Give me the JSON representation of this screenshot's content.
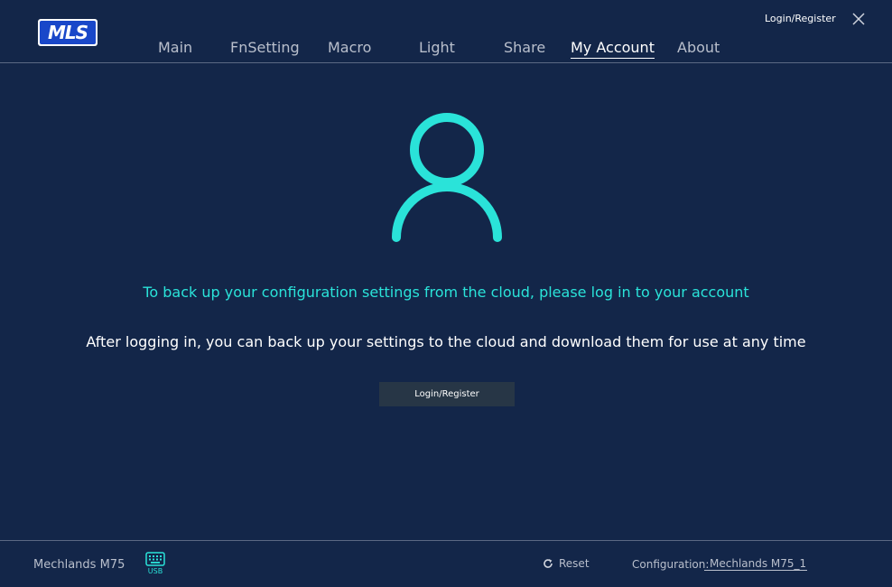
{
  "brand": {
    "logo_text": "MLS",
    "logo_bg": "#1947c9"
  },
  "header": {
    "tabs": [
      {
        "label": "Main"
      },
      {
        "label": "FnSetting"
      },
      {
        "label": "Macro"
      },
      {
        "label": "Light"
      },
      {
        "label": "Share"
      },
      {
        "label": "My Account"
      },
      {
        "label": "About"
      }
    ],
    "active_tab": "My Account",
    "login_link": "Login/Register",
    "close_icon": "close-icon"
  },
  "main": {
    "icon": "user-icon",
    "headline": "To back up your configuration settings from the cloud, please log in to your account",
    "subline": "After logging in, you can back up your settings to the cloud and download them for use at any time",
    "login_button": "Login/Register"
  },
  "footer": {
    "device_name": "Mechlands M75",
    "connection_label": "USB",
    "reset_label": "Reset",
    "config_label": "Configuration:",
    "config_value": "Mechlands M75_1"
  },
  "colors": {
    "background": "#132649",
    "accent": "#2ae3d9",
    "muted_text": "#b9bfcc",
    "divider": "#5b6883",
    "button_bg": "#273646"
  }
}
